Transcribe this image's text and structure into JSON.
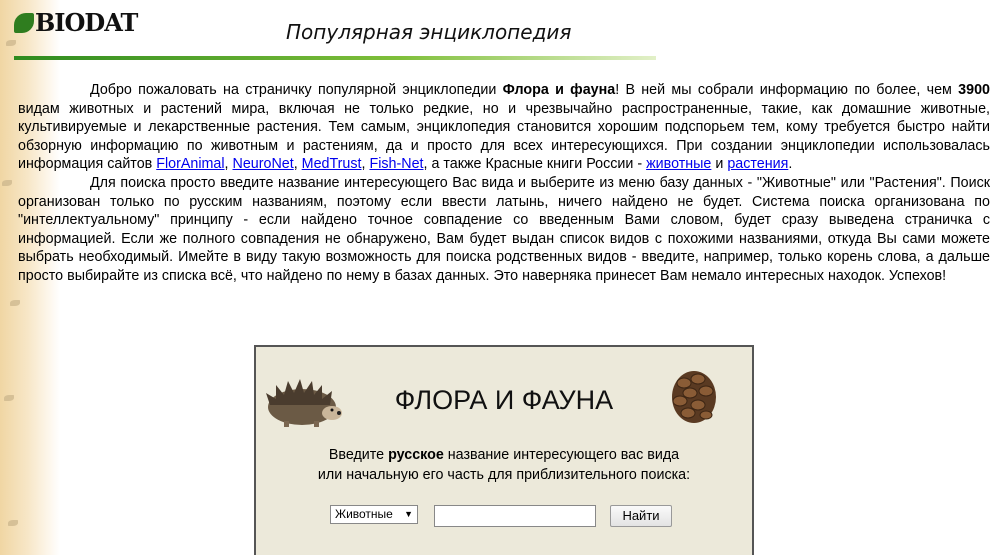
{
  "header": {
    "logo_text": "BIODAT",
    "site_title": "Популярная энциклопедия"
  },
  "intro": {
    "p1_text_1": "Добро пожаловать на страничку популярной энциклопедии ",
    "p1_bold_1": "Флора и фауна",
    "p1_text_2": "! В ней мы собрали информацию по более, чем ",
    "p1_bold_2": "3900",
    "p1_text_3": " видам животных и растений мира, включая не только редкие, но и чрезвычайно распространенные, такие, как домашние животные, культивируемые и лекарственные растения. Тем самым, энциклопедия становится хорошим подспорьем тем, кому требуется быстро найти обзорную информацию по животным и растениям, да и просто для всех интересующихся. При создании энциклопедии использовалась информация сайтов ",
    "link_1": "FlorAnimal",
    "sep_1": ", ",
    "link_2": "NeuroNet",
    "sep_2": ", ",
    "link_3": "MedTrust",
    "sep_3": ", ",
    "link_4": "Fish-Net",
    "p1_text_4": ", а также Красные книги России - ",
    "link_5": "животные",
    "p1_text_5": " и ",
    "link_6": "растения",
    "p1_text_6": ".",
    "p2_text": "Для поиска просто введите название интересующего Вас вида и выберите из меню базу данных - \"Животные\" или \"Растения\". Поиск организован только по русским названиям, поэтому если ввести латынь, ничего найдено не будет. Система поиска организована по \"интеллектуальному\" принципу - если найдено точное совпадение со введенным Вами словом, будет сразу выведена страничка с информацией. Если же полного совпадения не обнаружено, Вам будет выдан список видов с похожими названиями, откуда Вы сами можете выбрать необходимый. Имейте в виду такую возможность для поиска родственных видов - введите, например, только корень слова, а дальше просто выбирайте из списка всё, что найдено по нему в базах данных. Это наверняка принесет Вам немало интересных находок. Успехов!"
  },
  "search_panel": {
    "title": "ФЛОРА И ФАУНА",
    "instr_1": "Введите ",
    "instr_bold": "русское",
    "instr_2": " название интересующего вас вида",
    "instr_line2": "или начальную его часть для приблизительного поиска:",
    "select_value": "Животные",
    "select_arrow": "▼",
    "input_value": "",
    "button_label": "Найти"
  },
  "colors": {
    "accent_green": "#2e8b1f",
    "panel_bg": "#ece9da",
    "link": "#0000ee"
  },
  "icons": [
    "logo-leaf-icon",
    "hedgehog-icon",
    "pinecone-icon",
    "dropdown-arrow-icon"
  ]
}
